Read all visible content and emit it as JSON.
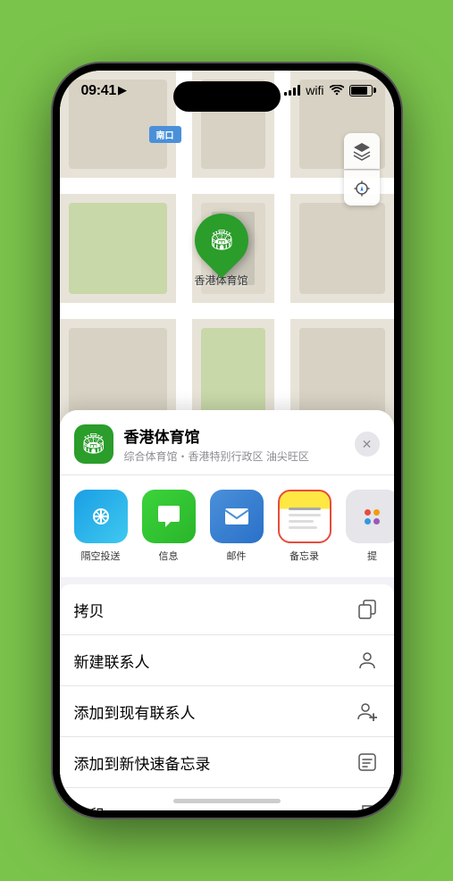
{
  "status": {
    "time": "09:41",
    "location_arrow": "▶"
  },
  "map": {
    "label_south": "南口",
    "location_name": "香港体育馆",
    "location_desc": "综合体育馆・香港特别行政区 油尖旺区"
  },
  "share_items": [
    {
      "id": "airdrop",
      "label": "隔空投送",
      "emoji": "📡"
    },
    {
      "id": "messages",
      "label": "信息",
      "emoji": "💬"
    },
    {
      "id": "mail",
      "label": "邮件",
      "emoji": "✉️"
    },
    {
      "id": "notes",
      "label": "备忘录",
      "emoji": ""
    },
    {
      "id": "more",
      "label": "提",
      "emoji": ""
    }
  ],
  "actions": [
    {
      "id": "copy",
      "label": "拷贝",
      "icon": "copy"
    },
    {
      "id": "new-contact",
      "label": "新建联系人",
      "icon": "person"
    },
    {
      "id": "add-contact",
      "label": "添加到现有联系人",
      "icon": "person-add"
    },
    {
      "id": "quick-note",
      "label": "添加到新快速备忘录",
      "icon": "note"
    },
    {
      "id": "print",
      "label": "打印",
      "icon": "print"
    }
  ]
}
